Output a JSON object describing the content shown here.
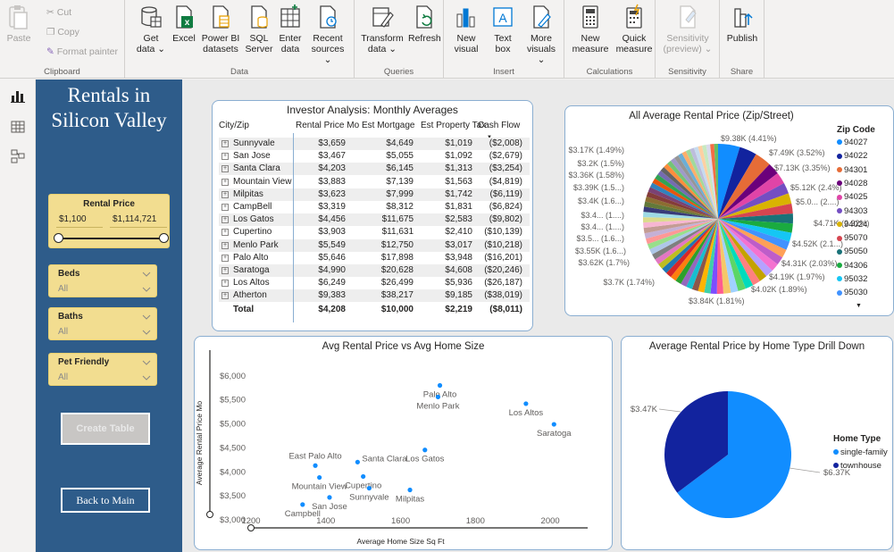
{
  "ribbon": {
    "clipboard": {
      "label": "Clipboard",
      "paste": "Paste",
      "cut": "Cut",
      "copy": "Copy",
      "format_painter": "Format painter"
    },
    "data": {
      "label": "Data",
      "get_data": [
        "Get",
        "data ⌄"
      ],
      "excel": "Excel",
      "power_bi": [
        "Power BI",
        "datasets"
      ],
      "sql": [
        "SQL",
        "Server"
      ],
      "enter": [
        "Enter",
        "data"
      ],
      "recent": [
        "Recent",
        "sources ⌄"
      ]
    },
    "queries": {
      "label": "Queries",
      "transform": [
        "Transform",
        "data ⌄"
      ],
      "refresh": "Refresh"
    },
    "insert": {
      "label": "Insert",
      "new_visual": [
        "New",
        "visual"
      ],
      "text_box": [
        "Text",
        "box"
      ],
      "more_visuals": [
        "More",
        "visuals ⌄"
      ]
    },
    "calculations": {
      "label": "Calculations",
      "new_measure": [
        "New",
        "measure"
      ],
      "quick_measure": [
        "Quick",
        "measure"
      ]
    },
    "sensitivity": {
      "label": "Sensitivity",
      "btn": [
        "Sensitivity",
        "(preview) ⌄"
      ]
    },
    "share": {
      "label": "Share",
      "publish": "Publish"
    }
  },
  "side": {
    "title_line1": "Rentals in",
    "title_line2": "Silicon Valley",
    "rental_price": {
      "header": "Rental Price",
      "min": "$1,100",
      "max": "$1,114,721"
    },
    "beds": {
      "header": "Beds",
      "value": "All"
    },
    "baths": {
      "header": "Baths",
      "value": "All"
    },
    "pet": {
      "header": "Pet Friendly",
      "value": "All"
    },
    "create_table": "Create Table",
    "back_main": "Back to Main"
  },
  "table": {
    "title": "Investor Analysis: Monthly Averages",
    "headers": [
      "City/Zip",
      "Rental Price Mo",
      "Est Mortgage",
      "Est Property Tax",
      "Cash Flow"
    ],
    "rows": [
      [
        "Sunnyvale",
        "$3,659",
        "$4,649",
        "$1,019",
        "($2,008)"
      ],
      [
        "San Jose",
        "$3,467",
        "$5,055",
        "$1,092",
        "($2,679)"
      ],
      [
        "Santa Clara",
        "$4,203",
        "$6,145",
        "$1,313",
        "($3,254)"
      ],
      [
        "Mountain View",
        "$3,883",
        "$7,139",
        "$1,563",
        "($4,819)"
      ],
      [
        "Milpitas",
        "$3,623",
        "$7,999",
        "$1,742",
        "($6,119)"
      ],
      [
        "CampBell",
        "$3,319",
        "$8,312",
        "$1,831",
        "($6,824)"
      ],
      [
        "Los Gatos",
        "$4,456",
        "$11,675",
        "$2,583",
        "($9,802)"
      ],
      [
        "Cupertino",
        "$3,903",
        "$11,631",
        "$2,410",
        "($10,139)"
      ],
      [
        "Menlo Park",
        "$5,549",
        "$12,750",
        "$3,017",
        "($10,218)"
      ],
      [
        "Palo Alto",
        "$5,646",
        "$17,898",
        "$3,948",
        "($16,201)"
      ],
      [
        "Saratoga",
        "$4,990",
        "$20,628",
        "$4,608",
        "($20,246)"
      ],
      [
        "Los Altos",
        "$6,249",
        "$26,499",
        "$5,936",
        "($26,187)"
      ],
      [
        "Atherton",
        "$9,383",
        "$38,217",
        "$9,185",
        "($38,019)"
      ]
    ],
    "total": [
      "Total",
      "$4,208",
      "$10,000",
      "$2,219",
      "($8,011)"
    ]
  },
  "chart_data": [
    {
      "type": "pie",
      "title": "All Average Rental Price (Zip/Street)",
      "legend_title": "Zip Code",
      "legend": [
        "94027",
        "94022",
        "94301",
        "94028",
        "94025",
        "94303",
        "94024",
        "95070",
        "95050",
        "94306",
        "95032",
        "95030"
      ],
      "labels": [
        "$9.38K (4.41%)",
        "$7.49K (3.52%)",
        "$7.13K (3.35%)",
        "$5.12K (2.4%)",
        "$5.0... (2....)",
        "$4.71K (2.22%)",
        "$4.52K (2.1...)",
        "$4.31K (2.03%)",
        "$4.19K (1.97%)",
        "$4.02K (1.89%)",
        "$3.84K (1.81%)",
        "$3.7K (1.74%)",
        "$3.62K (1.7%)",
        "$3.55K (1.6...)",
        "$3.5... (1.6...)",
        "$3.4... (1....)",
        "$3.4... (1....)",
        "$3.4K (1.6...)",
        "$3.39K (1.5...)",
        "$3.36K (1.58%)",
        "$3.2K (1.5%)",
        "$3.17K (1.49%)"
      ],
      "values": [
        9.38,
        7.49,
        7.13,
        5.12,
        5.0,
        4.71,
        4.52,
        4.31,
        4.19,
        4.02,
        3.84,
        3.7,
        3.62,
        3.55,
        3.5,
        3.45,
        3.42,
        3.4,
        3.39,
        3.36,
        3.2,
        3.17
      ]
    },
    {
      "type": "scatter",
      "title": "Avg Rental Price vs Avg Home Size",
      "xlabel": "Average Home Size Sq Ft",
      "ylabel": "Average Rental Price Mo",
      "xlim": [
        1200,
        2100
      ],
      "ylim": [
        3000,
        6200
      ],
      "xticks": [
        "1200",
        "1400",
        "1600",
        "1800",
        "2000"
      ],
      "yticks": [
        "$3,000",
        "$3,500",
        "$4,000",
        "$4,500",
        "$5,000",
        "$5,500",
        "$6,000"
      ],
      "points": [
        {
          "label": "Palo Alto",
          "x": 1705,
          "y": 5800
        },
        {
          "label": "Menlo Park",
          "x": 1700,
          "y": 5560
        },
        {
          "label": "Los Altos",
          "x": 1935,
          "y": 5420
        },
        {
          "label": "Saratoga",
          "x": 2010,
          "y": 4990
        },
        {
          "label": "Los Gatos",
          "x": 1665,
          "y": 4456
        },
        {
          "label": "Santa Clara",
          "x": 1485,
          "y": 4203
        },
        {
          "label": "East Palo Alto",
          "x": 1372,
          "y": 4130
        },
        {
          "label": "Cupertino",
          "x": 1500,
          "y": 3903
        },
        {
          "label": "Mountain View",
          "x": 1383,
          "y": 3883
        },
        {
          "label": "Sunnyvale",
          "x": 1516,
          "y": 3659
        },
        {
          "label": "Milpitas",
          "x": 1625,
          "y": 3623
        },
        {
          "label": "San Jose",
          "x": 1410,
          "y": 3467
        },
        {
          "label": "Campbell",
          "x": 1338,
          "y": 3319
        }
      ]
    },
    {
      "type": "pie",
      "title": "Average Rental Price by Home Type Drill Down",
      "legend_title": "Home Type",
      "categories": [
        "single-family",
        "townhouse"
      ],
      "values": [
        6.37,
        3.47
      ],
      "labels": [
        "$6.37K",
        "$3.47K"
      ],
      "colors": [
        "#118dff",
        "#12239e"
      ]
    }
  ]
}
